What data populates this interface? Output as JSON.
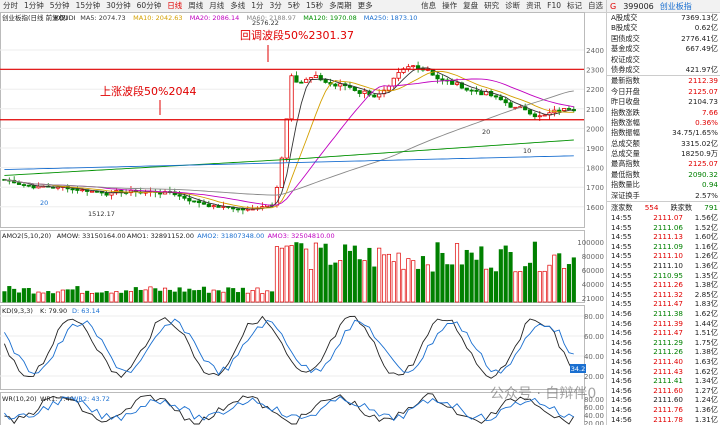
{
  "toolbar": {
    "periods": [
      "分时",
      "1分钟",
      "5分钟",
      "15分钟",
      "30分钟",
      "60分钟",
      "日线",
      "周线",
      "月线",
      "多线",
      "1分",
      "3分",
      "5秒",
      "15秒",
      "多周期",
      "更多"
    ],
    "active_index": 6,
    "right_items": [
      "信息",
      "操作",
      "复盘",
      "研究",
      "诊断",
      "资讯",
      "F10",
      "标记",
      "自选"
    ]
  },
  "legend_main": {
    "name": "创业板指(日线 前复权)",
    "indicator": "KOUDI",
    "ma5": "MA5: 2074.73",
    "ma10": "MA10: 2042.63",
    "ma20": "MA20: 2086.14",
    "ma60": "MA60: 2188.97",
    "ma120": "MA120: 1970.08",
    "ma250": "MA250: 1873.10"
  },
  "annotations": {
    "retrace": "回调波段50%2301.37",
    "rise": "上涨波段50%2044",
    "high_mark": "2576.22",
    "low_mark": "1512.17",
    "point_20a": "20",
    "point_20b": "20",
    "point_10": "10"
  },
  "price_axis": [
    "2400",
    "2300",
    "2200",
    "2100",
    "2000",
    "1900",
    "1800",
    "1700",
    "1600"
  ],
  "volume_legend": {
    "name": "AMO2(5,10,20)",
    "amow": "AMOW: 33150164.00",
    "amo1": "AMO1: 32891152.00",
    "amo2": "AMO2: 31807348.00",
    "amo3": "AMO3: 32504810.00"
  },
  "volume_axis": [
    "100000",
    "80000",
    "60000",
    "40000",
    "21000"
  ],
  "kdj_legend": {
    "name": "KD(9,3,3)",
    "k": "K: 79.90",
    "d": "D: 63.14"
  },
  "kdj_axis": [
    "80.00",
    "60.00",
    "40.00",
    "20.00"
  ],
  "kdj_marker": "34.2",
  "wr_legend": {
    "name": "WR(10,20)",
    "wr1": "WR1: 7.40",
    "wr2": "WR2: 43.72"
  },
  "wr_axis": [
    "80.00",
    "60.00",
    "40.00",
    "20.00"
  ],
  "sidebar": {
    "g": "G",
    "code": "399006",
    "name": "创业板指",
    "stats": [
      {
        "label": "A股成交",
        "value": "7369.13亿",
        "cls": "blk"
      },
      {
        "label": "B股成交",
        "value": "0.62亿",
        "cls": "blk"
      },
      {
        "label": "国债成交",
        "value": "2776.41亿",
        "cls": "blk"
      },
      {
        "label": "基金成交",
        "value": "667.49亿",
        "cls": "blk"
      },
      {
        "label": "权证成交",
        "value": "",
        "cls": "blk"
      },
      {
        "label": "债券成交",
        "value": "421.97亿",
        "cls": "blk"
      },
      {
        "label": "最新指数",
        "value": "2112.39",
        "cls": "red"
      },
      {
        "label": "今日开盘",
        "value": "2125.07",
        "cls": "red"
      },
      {
        "label": "昨日收盘",
        "value": "2104.73",
        "cls": "blk"
      },
      {
        "label": "指数涨跌",
        "value": "7.66",
        "cls": "red"
      },
      {
        "label": "指数涨幅",
        "value": "0.36%",
        "cls": "red"
      },
      {
        "label": "指数振幅",
        "value": "34.75/1.65%",
        "cls": "blk"
      },
      {
        "label": "总成交额",
        "value": "3315.02亿",
        "cls": "blk"
      },
      {
        "label": "总成交量",
        "value": "18250.9万",
        "cls": "blk"
      },
      {
        "label": "最高指数",
        "value": "2125.07",
        "cls": "red"
      },
      {
        "label": "最低指数",
        "value": "2090.32",
        "cls": "grn"
      },
      {
        "label": "指数量比",
        "value": "0.94",
        "cls": "grn"
      },
      {
        "label": "深证换手",
        "value": "2.57%",
        "cls": "blk"
      }
    ],
    "trades_header": {
      "left": "涨家数",
      "mid": "554",
      "mid_label": "跌家数",
      "right": "791"
    },
    "trades": [
      {
        "t": "14:55",
        "p": "2111.07",
        "v": "1.56亿",
        "c": "red"
      },
      {
        "t": "14:55",
        "p": "2111.06",
        "v": "1.52亿",
        "c": "grn"
      },
      {
        "t": "14:55",
        "p": "2111.13",
        "v": "1.60亿",
        "c": "red"
      },
      {
        "t": "14:55",
        "p": "2111.09",
        "v": "1.16亿",
        "c": "grn"
      },
      {
        "t": "14:55",
        "p": "2111.10",
        "v": "1.26亿",
        "c": "red"
      },
      {
        "t": "14:55",
        "p": "2111.10",
        "v": "1.36亿",
        "c": "blk"
      },
      {
        "t": "14:55",
        "p": "2110.95",
        "v": "1.35亿",
        "c": "grn"
      },
      {
        "t": "14:55",
        "p": "2111.26",
        "v": "1.38亿",
        "c": "red"
      },
      {
        "t": "14:55",
        "p": "2111.32",
        "v": "2.85亿",
        "c": "red"
      },
      {
        "t": "14:55",
        "p": "2111.47",
        "v": "1.83亿",
        "c": "red"
      },
      {
        "t": "14:56",
        "p": "2111.38",
        "v": "1.62亿",
        "c": "grn"
      },
      {
        "t": "14:56",
        "p": "2111.39",
        "v": "1.44亿",
        "c": "red"
      },
      {
        "t": "14:56",
        "p": "2111.47",
        "v": "1.51亿",
        "c": "red"
      },
      {
        "t": "14:56",
        "p": "2111.29",
        "v": "1.75亿",
        "c": "grn"
      },
      {
        "t": "14:56",
        "p": "2111.26",
        "v": "1.38亿",
        "c": "grn"
      },
      {
        "t": "14:56",
        "p": "2111.40",
        "v": "1.63亿",
        "c": "red"
      },
      {
        "t": "14:56",
        "p": "2111.43",
        "v": "1.62亿",
        "c": "red"
      },
      {
        "t": "14:56",
        "p": "2111.41",
        "v": "1.34亿",
        "c": "grn"
      },
      {
        "t": "14:56",
        "p": "2111.60",
        "v": "1.27亿",
        "c": "red"
      },
      {
        "t": "14:56",
        "p": "2111.60",
        "v": "1.24亿",
        "c": "blk"
      },
      {
        "t": "14:56",
        "p": "2111.76",
        "v": "1.36亿",
        "c": "red"
      },
      {
        "t": "14:56",
        "p": "2111.78",
        "v": "1.31亿",
        "c": "red"
      }
    ]
  },
  "watermark": "公众号 · 白辩伴0"
}
